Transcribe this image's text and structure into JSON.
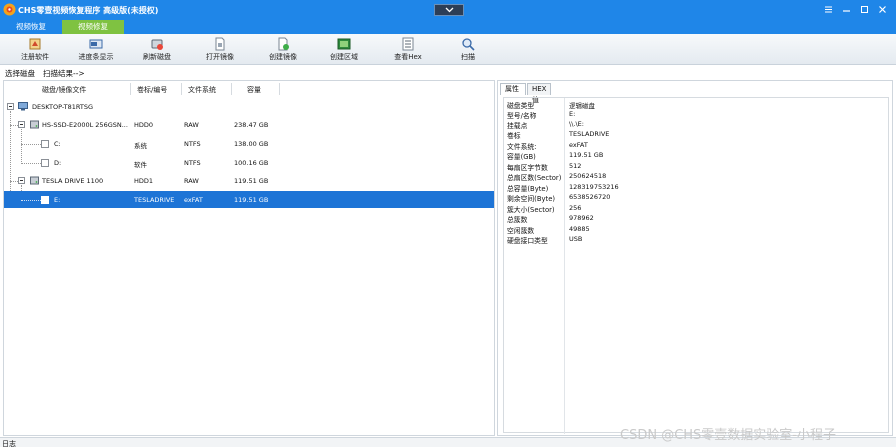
{
  "window": {
    "title": "CHS零壹视频恢复程序 高级版(未授权)"
  },
  "tabs": [
    {
      "label": "视频恢复"
    },
    {
      "label": "视频修复"
    }
  ],
  "toolbar": {
    "items": [
      {
        "label": "注册软件",
        "icon": "register-icon"
      },
      {
        "label": "进度条显示",
        "icon": "progress-icon"
      },
      {
        "label": "刷新磁盘",
        "icon": "refresh-disk-icon"
      },
      {
        "label": "打开镜像",
        "icon": "open-image-icon"
      },
      {
        "label": "创建镜像",
        "icon": "create-image-icon"
      },
      {
        "label": "创建区域",
        "icon": "create-region-icon"
      },
      {
        "label": "查看Hex",
        "icon": "hex-view-icon"
      },
      {
        "label": "扫描",
        "icon": "scan-icon"
      }
    ]
  },
  "breadcrumb": {
    "step1": "选择磁盘",
    "step2": "扫描结果-->"
  },
  "disk_table": {
    "headers": [
      "磁盘/镜像文件",
      "卷标/编号",
      "文件系统",
      "容量"
    ],
    "rows": [
      {
        "name": "DESKTOP-T81RTSG",
        "label": "",
        "fs": "",
        "size": ""
      },
      {
        "name": "HS-SSD-E2000L 256GSN...",
        "label": "HDD0",
        "fs": "RAW",
        "size": "238.47 GB"
      },
      {
        "name": "C:",
        "label": "系统",
        "fs": "NTFS",
        "size": "138.00 GB"
      },
      {
        "name": "D:",
        "label": "软件",
        "fs": "NTFS",
        "size": "100.16 GB"
      },
      {
        "name": "TESLA   DRIVE        1100",
        "label": "HDD1",
        "fs": "RAW",
        "size": "119.51 GB"
      },
      {
        "name": "E:",
        "label": "TESLADRIVE",
        "fs": "exFAT",
        "size": "119.51 GB"
      }
    ]
  },
  "properties": {
    "tabs": [
      "属性",
      "HEX值"
    ],
    "rows": [
      {
        "key": "磁盘类型",
        "value": "逻辑磁盘"
      },
      {
        "key": "型号/名称",
        "value": "E:"
      },
      {
        "key": "挂载点",
        "value": "\\\\.\\E:"
      },
      {
        "key": "卷标",
        "value": "TESLADRIVE"
      },
      {
        "key": "文件系统:",
        "value": "exFAT"
      },
      {
        "key": "容量(GB)",
        "value": "119.51 GB"
      },
      {
        "key": "每扇区字节数",
        "value": "512"
      },
      {
        "key": "总扇区数(Sector)",
        "value": "250624518"
      },
      {
        "key": "总容量(Byte)",
        "value": "128319753216"
      },
      {
        "key": "剩余空间(Byte)",
        "value": "6538526720"
      },
      {
        "key": "簇大小(Sector)",
        "value": "256"
      },
      {
        "key": "总簇数",
        "value": "978962"
      },
      {
        "key": "空闲簇数",
        "value": "49885"
      },
      {
        "key": "硬盘接口类型",
        "value": "USB"
      }
    ]
  },
  "log": {
    "label": "日志"
  },
  "watermark": "CSDN @CHS零壹数据实验室-小程子",
  "colors": {
    "titlebar": "#1f86e8",
    "tab_active": "#7fc241",
    "selection": "#1d74d6"
  }
}
